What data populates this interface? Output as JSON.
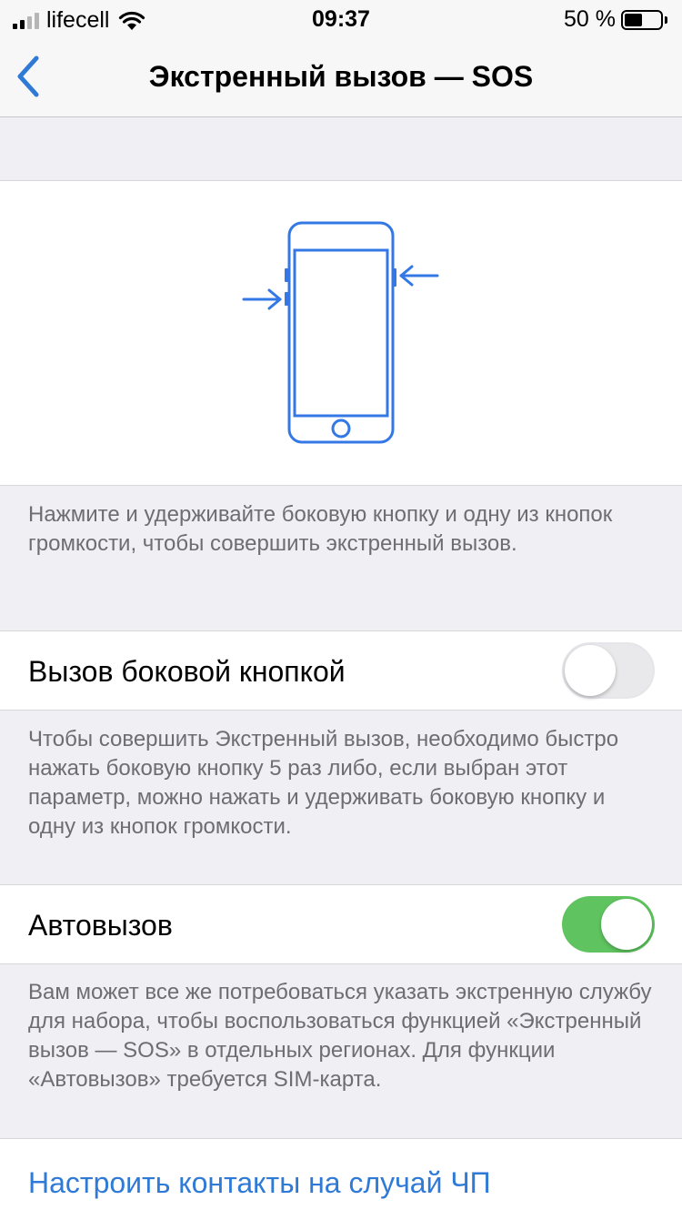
{
  "status_bar": {
    "carrier": "lifecell",
    "time": "09:37",
    "battery": "50 %",
    "battery_level": 0.5
  },
  "nav": {
    "title": "Экстренный вызов — SOS",
    "back_icon": "chevron-left-icon"
  },
  "illustration": {
    "icon": "iphone-side-buttons-icon",
    "accent": "#3478e5"
  },
  "footers": {
    "illustration_hint": "Нажмите и удерживайте боковую кнопку и одну из кнопок громкости, чтобы совершить экстренный вызов.",
    "side_button_hint": "Чтобы совершить Экстренный вызов, необходимо быстро нажать боковую кнопку 5 раз либо, если выбран этот параметр, можно нажать и удерживать боковую кнопку и одну из кнопок громкости.",
    "auto_call_hint": "Вам может все же потребоваться указать экстренную службу для набора, чтобы воспользоваться функцией «Экстренный вызов — SOS» в отдельных регионах. Для функции «Автовызов» требуется SIM-карта."
  },
  "settings": {
    "side_button_call": {
      "label": "Вызов боковой кнопкой",
      "enabled": false
    },
    "auto_call": {
      "label": "Автовызов",
      "enabled": true
    },
    "emergency_contacts": {
      "label": "Настроить контакты на случай ЧП"
    }
  },
  "colors": {
    "accent": "#2f7ad6",
    "toggle_on": "#5fc45f",
    "background": "#efeff4"
  }
}
